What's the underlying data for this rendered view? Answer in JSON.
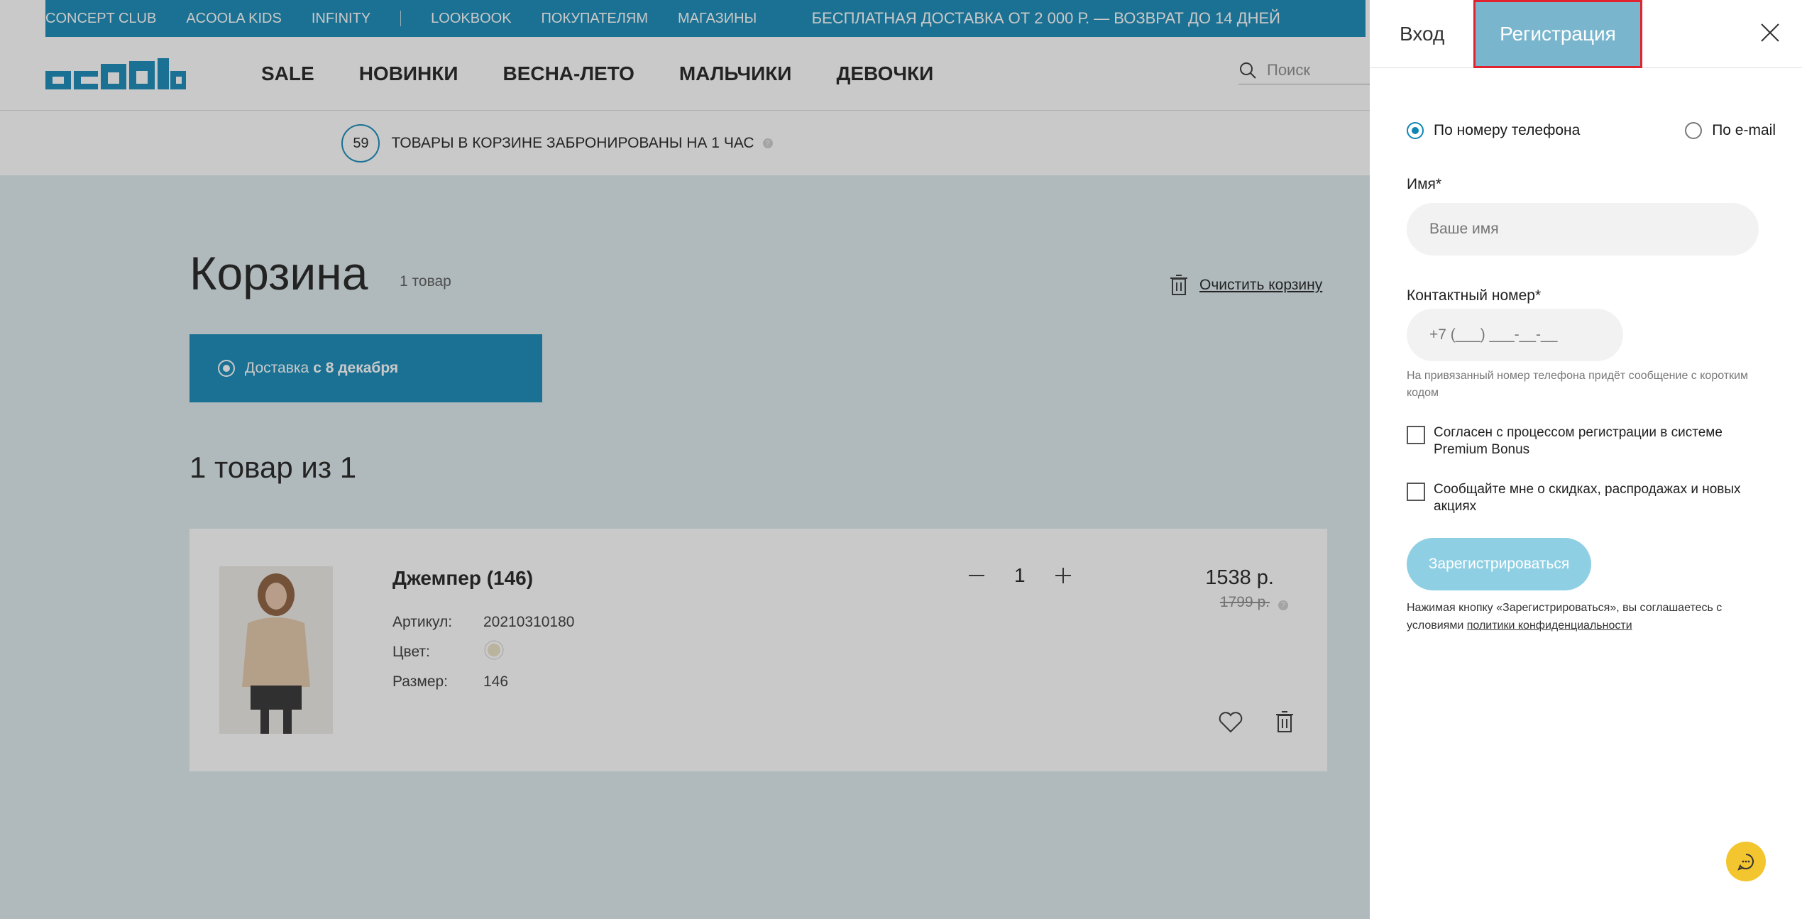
{
  "topbar": {
    "links": [
      "CONCEPT CLUB",
      "ACOOLA KIDS",
      "INFINITY",
      "LOOKBOOK",
      "ПОКУПАТЕЛЯМ",
      "МАГАЗИНЫ"
    ],
    "promo": "БЕСПЛАТНАЯ ДОСТАВКА ОТ 2 000 Р. — ВОЗВРАТ ДО 14 ДНЕЙ"
  },
  "header": {
    "logo": "acoola",
    "nav": [
      "SALE",
      "НОВИНКИ",
      "ВЕСНА-ЛЕТО",
      "МАЛЬЧИКИ",
      "ДЕВОЧКИ"
    ],
    "search_placeholder": "Поиск"
  },
  "reserve": {
    "timer": "59",
    "text": "ТОВАРЫ В КОРЗИНЕ ЗАБРОНИРОВАНЫ НА 1 ЧАС"
  },
  "cart": {
    "title": "Корзина",
    "count": "1 товар",
    "clear": "Очистить корзину",
    "delivery_prefix": "Доставка",
    "delivery_date": "с 8 декабря",
    "items_title": "1 товар из 1",
    "item": {
      "name": "Джемпер (146)",
      "article_label": "Артикул:",
      "article": "20210310180",
      "color_label": "Цвет:",
      "size_label": "Размер:",
      "size": "146",
      "qty": "1",
      "price": "1538 р.",
      "old_price": "1799 р."
    }
  },
  "panel": {
    "tab_login": "Вход",
    "tab_register": "Регистрация",
    "radio_phone": "По номеру телефона",
    "radio_email": "По e-mail",
    "name_label": "Имя*",
    "name_placeholder": "Ваше имя",
    "phone_label": "Контактный номер*",
    "phone_placeholder": "+7 (___) ___-__-__",
    "phone_hint": "На привязанный номер телефона придёт сообщение с коротким кодом",
    "check1": "Согласен с процессом регистрации в системе Premium Bonus",
    "check2": "Сообщайте мне о скидках, распродажах и новых акциях",
    "register_button": "Зарегистрироваться",
    "terms_prefix": "Нажимая кнопку «Зарегистрироваться», вы соглашаетесь с условиями",
    "terms_link": "политики конфиденциальности"
  },
  "colors": {
    "brand": "#0e86b4",
    "accent_chat": "#f3c52e",
    "highlight_border": "#e0232e"
  }
}
